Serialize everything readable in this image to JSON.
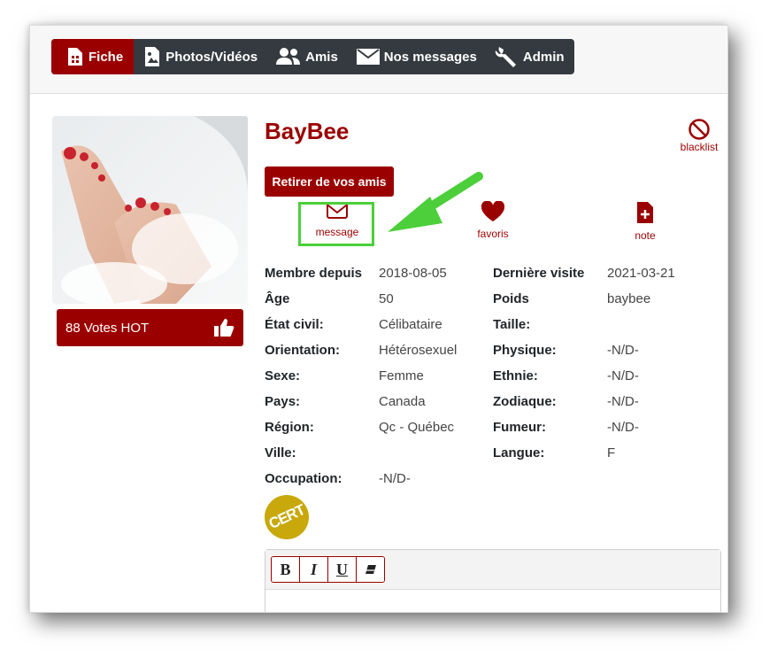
{
  "tabs": [
    {
      "label": "Fiche",
      "icon": "profile-card-icon",
      "active": true
    },
    {
      "label": "Photos/Vidéos",
      "icon": "photo-icon"
    },
    {
      "label": "Amis",
      "icon": "friends-icon"
    },
    {
      "label": "Nos messages",
      "icon": "envelope-icon"
    },
    {
      "label": "Admin",
      "icon": "wrench-icon"
    }
  ],
  "profile": {
    "name": "BayBee",
    "votes": "88 Votes HOT",
    "remove_friend_label": "Retirer de vos amis",
    "blacklist_label": "blacklist",
    "cert_label": "CERT"
  },
  "actions": {
    "message": "message",
    "favoris": "favoris",
    "note": "note"
  },
  "info_left": [
    {
      "label": "Membre depuis",
      "value": "2018-08-05"
    },
    {
      "label": "Âge",
      "value": "50"
    },
    {
      "label": "État civil:",
      "value": "Célibataire"
    },
    {
      "label": "Orientation:",
      "value": "Hétérosexuel"
    },
    {
      "label": "Sexe:",
      "value": "Femme"
    },
    {
      "label": "Pays:",
      "value": "Canada"
    },
    {
      "label": "Région:",
      "value": "Qc - Québec"
    },
    {
      "label": "Ville:",
      "value": ""
    },
    {
      "label": "Occupation:",
      "value": "-N/D-"
    }
  ],
  "info_right": [
    {
      "label": "Dernière visite",
      "value": "2021-03-21"
    },
    {
      "label": "Poids",
      "value": "baybee"
    },
    {
      "label": "Taille:",
      "value": ""
    },
    {
      "label": "Physique:",
      "value": "-N/D-"
    },
    {
      "label": "Ethnie:",
      "value": "-N/D-"
    },
    {
      "label": "Zodiaque:",
      "value": "-N/D-"
    },
    {
      "label": "Fumeur:",
      "value": "-N/D-"
    },
    {
      "label": "Langue:",
      "value": "F"
    }
  ],
  "editor": {
    "buttons": [
      "B",
      "I",
      "U"
    ]
  },
  "colors": {
    "brand": "#9b0000",
    "navbar": "#343a40",
    "highlight": "#4ccf3a"
  }
}
